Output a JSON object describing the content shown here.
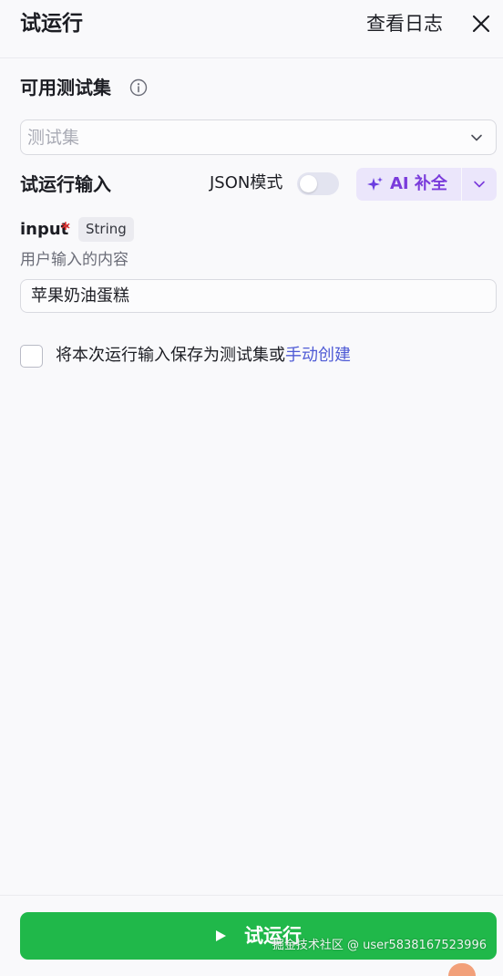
{
  "header": {
    "title": "试运行",
    "view_logs": "查看日志",
    "close_icon": "close-icon"
  },
  "testset": {
    "title": "可用测试集",
    "info_icon": "info-icon",
    "placeholder": "测试集",
    "chevron_icon": "chevron-down-icon"
  },
  "run_input": {
    "title": "试运行输入",
    "json_mode_label": "JSON模式",
    "json_mode_on": false,
    "ai_label": "AI 补全",
    "ai_icon": "sparkle-icon",
    "ai_dropdown_icon": "chevron-down-icon",
    "accent_color": "#7a3bdb"
  },
  "variable": {
    "name": "input",
    "required_mark": "*",
    "type": "String",
    "description": "用户输入的内容",
    "value": "苹果奶油蛋糕"
  },
  "save_option": {
    "checked": false,
    "text": "将本次运行输入保存为测试集或",
    "link": "手动创建"
  },
  "footer": {
    "run_label": "试运行",
    "run_icon": "play-icon",
    "run_color": "#20b84a"
  },
  "watermark": {
    "text": "掘金技术社区 @ user5838167523996"
  }
}
